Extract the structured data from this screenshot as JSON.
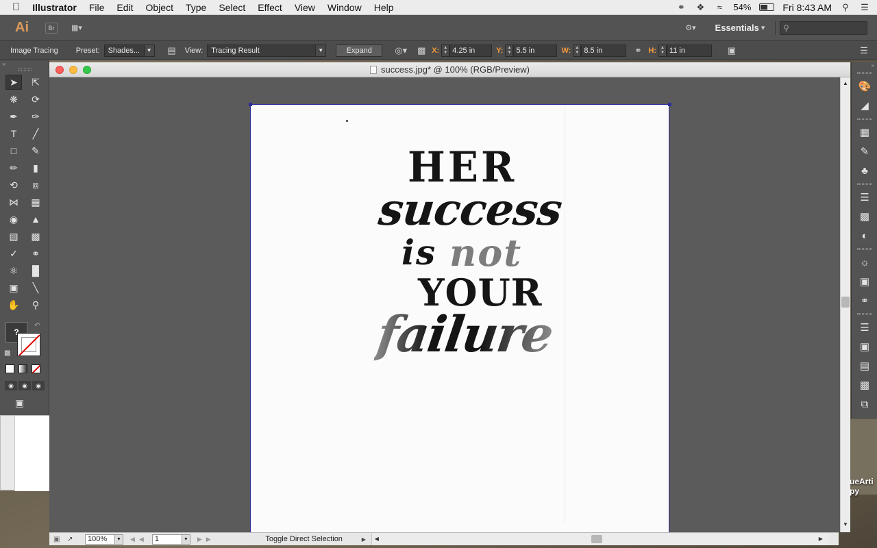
{
  "menubar": {
    "app_name": "Illustrator",
    "items": [
      "File",
      "Edit",
      "Object",
      "Type",
      "Select",
      "Effect",
      "View",
      "Window",
      "Help"
    ],
    "battery": "54%",
    "clock": "Fri 8:43 AM"
  },
  "appbar": {
    "logo": "Ai",
    "bridge": "Br",
    "workspace": "Essentials"
  },
  "controlbar": {
    "panel_name": "Image Tracing",
    "preset_label": "Preset:",
    "preset_value": "Shades...",
    "view_label": "View:",
    "view_value": "Tracing Result",
    "expand_label": "Expand",
    "x_label": "X:",
    "x_value": "4.25 in",
    "y_label": "Y:",
    "y_value": "5.5 in",
    "w_label": "W:",
    "w_value": "8.5 in",
    "h_label": "H:",
    "h_value": "11 in"
  },
  "document": {
    "title": "success.jpg* @ 100% (RGB/Preview)"
  },
  "artwork": {
    "line1": "HER",
    "line2": "success",
    "line3a": "is",
    "line3b": "not",
    "line4": "YOUR",
    "line5": "failure"
  },
  "statusbar": {
    "zoom": "100%",
    "artboard": "1",
    "status_text": "Toggle Direct Selection"
  },
  "desktop": {
    "partial_label_1": "ueArti",
    "partial_label_2": "py"
  },
  "tools": {
    "fill_stroke_question": "?"
  },
  "colors": {
    "ui_dark": "#535353",
    "accent_orange": "#f59a3a",
    "logo_orange": "#d99a5b",
    "artboard_border": "#2d2d9a"
  }
}
